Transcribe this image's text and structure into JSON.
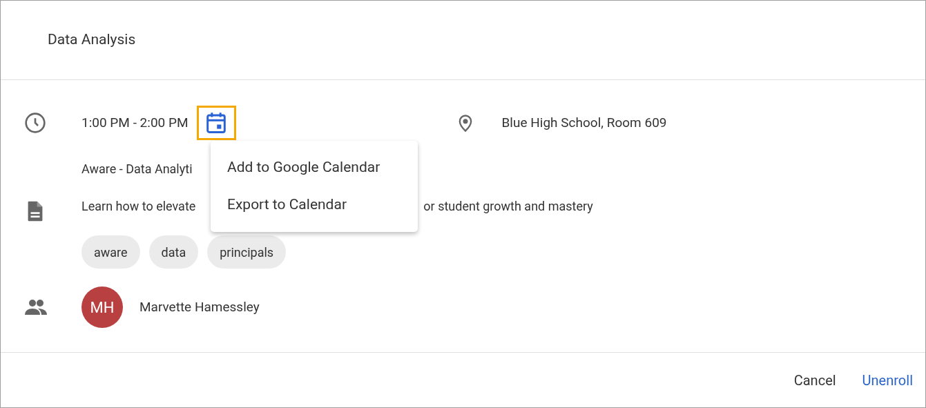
{
  "dialog": {
    "title": "Data Analysis"
  },
  "time": "1:00 PM - 2:00 PM",
  "location": "Blue High School, Room 609",
  "course": "Aware - Data Analyti",
  "description": [
    "Learn how to elevate",
    "or student growth and mastery"
  ],
  "tags": [
    "aware",
    "data",
    "principals"
  ],
  "attendee": {
    "initials": "MH",
    "name": "Marvette Hamessley",
    "color": "#b94040"
  },
  "calendar_menu": {
    "open": true,
    "items": [
      "Add to Google Calendar",
      "Export to Calendar"
    ]
  },
  "buttons": [
    {
      "label": "Cancel",
      "kind": "plain"
    },
    {
      "label": "Unenroll",
      "kind": "primary"
    }
  ]
}
